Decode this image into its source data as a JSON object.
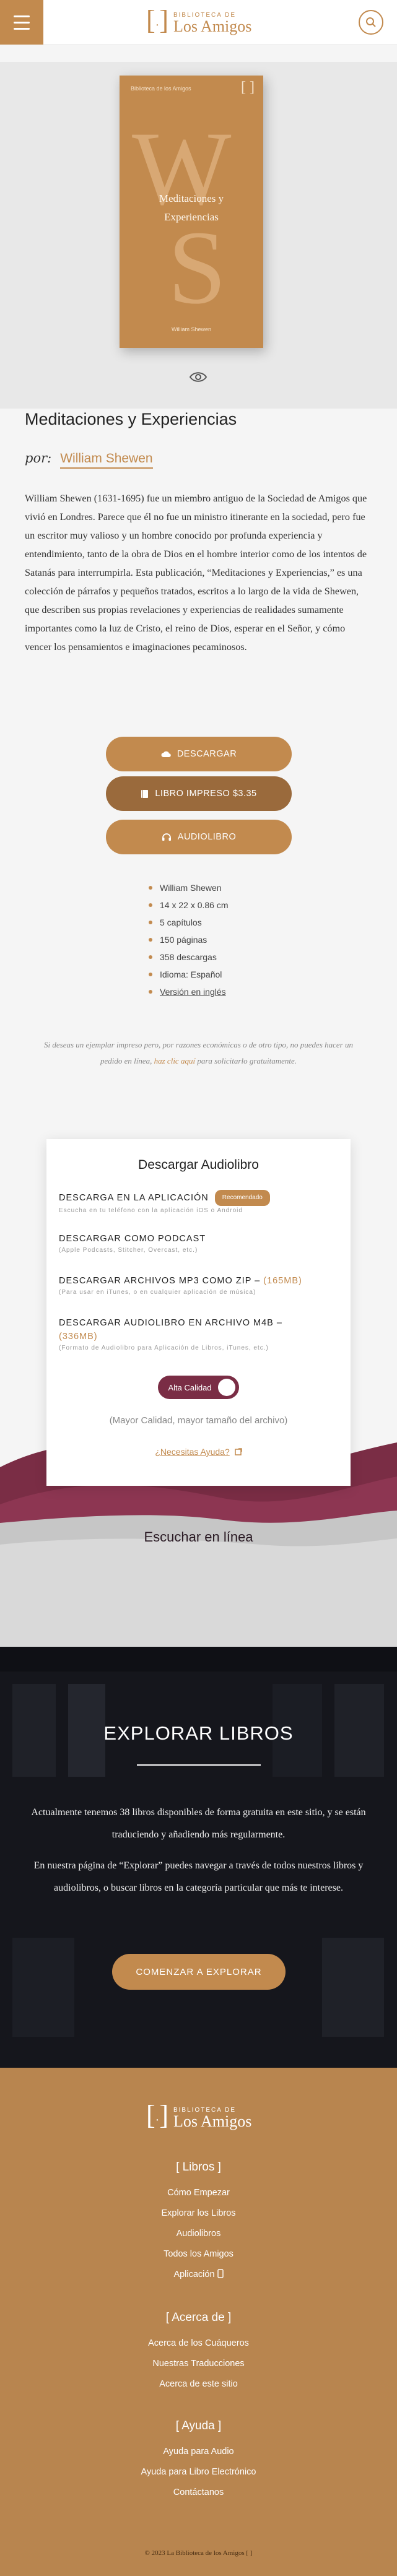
{
  "header": {
    "logo_top": "BIBLIOTECA DE",
    "logo_main": "Los Amigos",
    "logo_bracket": "[ ]"
  },
  "cover": {
    "series": "Biblioteca de los Amigos",
    "mark": "[ ]",
    "title_line1": "Meditaciones y",
    "title_line2": "Experiencias",
    "author": "William Shewen",
    "letters": [
      "W",
      "S"
    ]
  },
  "book": {
    "title": "Meditaciones y Experiencias",
    "by_prefix": "por:",
    "author": "William Shewen",
    "description": "William Shewen (1631-1695) fue un miembro antiguo de la Sociedad de Amigos que vivió en Londres. Parece que él no fue un ministro itinerante en la sociedad, pero fue un escritor muy valioso y un hombre conocido por profunda experiencia y entendimiento, tanto de la obra de Dios en el hombre interior como de los intentos de Satanás para interrumpirla. Esta publicación, “Meditaciones y Experiencias,” es una colección de párrafos y pequeños tratados, escritos a lo largo de la vida de Shewen, que describen sus propias revelaciones y experiencias de realidades sumamente importantes como la luz de Cristo, el reino de Dios, esperar en el Señor, y cómo vencer los pensamientos e imaginaciones pecaminosos."
  },
  "buttons": {
    "download": "Descargar",
    "print": "Libro impreso $3.35",
    "audio": "Audiolibro"
  },
  "specs": [
    {
      "text": "William Shewen",
      "link": false
    },
    {
      "text": "14 x 22 x 0.86 cm",
      "link": false
    },
    {
      "text": "5 capítulos",
      "link": false
    },
    {
      "text": "150 páginas",
      "link": false
    },
    {
      "text": "358 descargas",
      "link": false
    },
    {
      "text": "Idioma: Español",
      "link": false
    },
    {
      "text": "Versión en inglés",
      "link": true
    }
  ],
  "note": {
    "before": "Si deseas un ejemplar impreso pero, por razones económicas o de otro tipo, no puedes hacer un pedido en línea,",
    "link": "haz clic aquí",
    "after": "para solicitarlo gratuitamente."
  },
  "audio_card": {
    "title": "Descargar Audiolibro",
    "options": [
      {
        "title": "Descarga en la aplicación",
        "badge": "Recomendado",
        "size": "",
        "sub": "Escucha en tu teléfono con la aplicación iOS o Android"
      },
      {
        "title": "Descargar como podcast",
        "badge": "",
        "size": "",
        "sub": "(Apple Podcasts, Stitcher, Overcast, etc.)"
      },
      {
        "title": "Descargar archivos MP3 como ZIP –",
        "badge": "",
        "size": "(165MB)",
        "sub": "(Para usar en iTunes, o en cualquier aplicación de música)"
      },
      {
        "title": "Descargar audiolibro en archivo M4B –",
        "badge": "",
        "size": "(336MB)",
        "sub": "(Formato de Audiolibro para Aplicación de Libros, iTunes, etc.)"
      }
    ],
    "toggle_label": "Alta Calidad",
    "quality_note": "(Mayor Calidad, mayor tamaño del archivo)",
    "help": "¿Necesitas Ayuda?"
  },
  "listen_online": "Escuchar en línea",
  "explore": {
    "heading": "EXPLORAR LIBROS",
    "p1": "Actualmente tenemos 38 libros disponibles de forma gratuita en este sitio, y se están traduciendo y añadiendo más regularmente.",
    "p2": "En nuestra página de “Explorar” puedes navegar a través de todos nuestros libros y audiolibros, o buscar libros en la categoría particular que más te interese.",
    "cta": "Comenzar a Explorar"
  },
  "footer": {
    "sections": [
      {
        "heading": "[ Libros ]",
        "items": [
          "Cómo Empezar",
          "Explorar los Libros",
          "Audiolibros",
          "Todos los Amigos",
          "Aplicación"
        ]
      },
      {
        "heading": "[ Acerca de ]",
        "items": [
          "Acerca de los Cuáqueros",
          "Nuestras Traducciones",
          "Acerca de este sitio"
        ]
      },
      {
        "heading": "[ Ayuda ]",
        "items": [
          "Ayuda para Audio",
          "Ayuda para Libro Electrónico",
          "Contáctanos"
        ]
      }
    ],
    "copyright": "© 2023 La Biblioteca de los Amigos [ ]"
  },
  "colors": {
    "accent": "#c28a4e",
    "accent_dark": "#9a6a3c",
    "maroon": "#7a2d45",
    "dark": "#15161c"
  }
}
